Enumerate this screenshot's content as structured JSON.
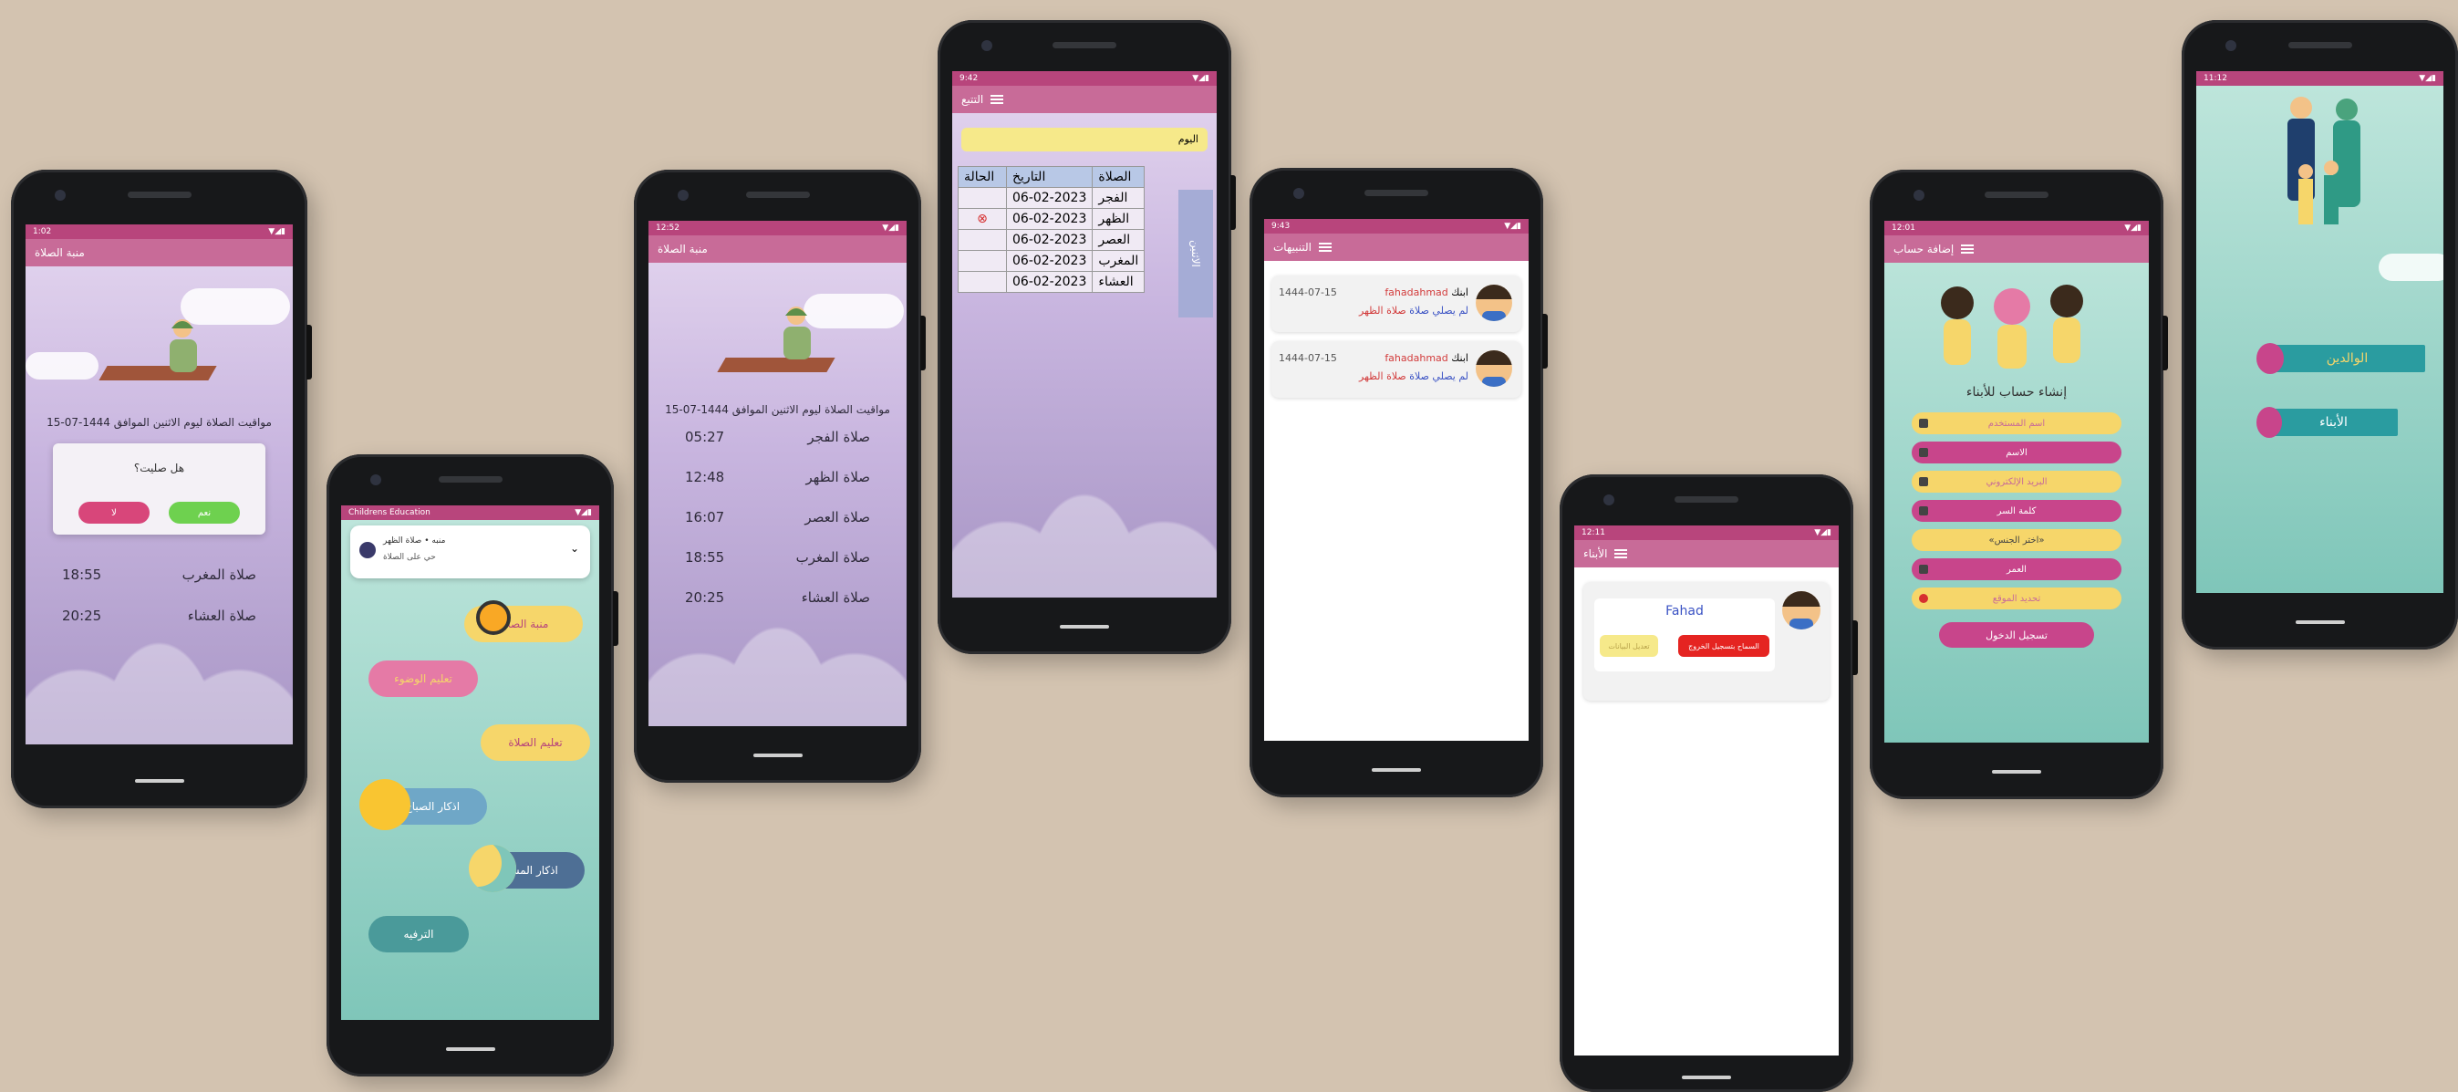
{
  "colors": {
    "background": "#d3c3b0",
    "status_bar": "#b8457c",
    "app_bar": "#c86b98",
    "accent_yellow": "#f6d66a",
    "accent_pink": "#c8458b"
  },
  "phone1": {
    "status_time": "1:02",
    "app_title": "منبة الصلاة",
    "date_line": "مواقيت الصلاة ليوم الاثنين الموافق 1444-07-15",
    "dialog": {
      "question": "هل صليت؟",
      "no_label": "لا",
      "yes_label": "نعم"
    },
    "prayers": [
      {
        "name": "صلاة المغرب",
        "time": "18:55"
      },
      {
        "name": "صلاة العشاء",
        "time": "20:25"
      }
    ]
  },
  "phone2": {
    "status_left": "Childrens Education",
    "notification": {
      "title": "منبه • صلاة الظهر",
      "body": "حي على الصلاة"
    },
    "menu": [
      {
        "label": "منبة الصلاة"
      },
      {
        "label": "تعليم الوضوء"
      },
      {
        "label": "تعليم الصلاة"
      },
      {
        "label": "اذكار الصباح"
      },
      {
        "label": "اذكار المساء"
      },
      {
        "label": "الترفيه"
      }
    ]
  },
  "phone3": {
    "status_time": "12:52",
    "app_title": "منبة الصلاة",
    "date_line": "مواقيت الصلاة ليوم الاثنين الموافق 1444-07-15",
    "prayers": [
      {
        "name": "صلاة الفجر",
        "time": "05:27"
      },
      {
        "name": "صلاة الظهر",
        "time": "12:48"
      },
      {
        "name": "صلاة العصر",
        "time": "16:07"
      },
      {
        "name": "صلاة المغرب",
        "time": "18:55"
      },
      {
        "name": "صلاة العشاء",
        "time": "20:25"
      }
    ]
  },
  "phone4": {
    "status_time": "9:42",
    "app_title": "التتبع",
    "day_chip": "اليوم",
    "side_tab": "الاثنين",
    "headers": {
      "prayer": "الصلاة",
      "date": "التاريخ",
      "status": "الحالة"
    },
    "rows": [
      {
        "prayer": "الفجر",
        "date": "06-02-2023",
        "missed": false
      },
      {
        "prayer": "الظهر",
        "date": "06-02-2023",
        "missed": true
      },
      {
        "prayer": "العصر",
        "date": "06-02-2023",
        "missed": false
      },
      {
        "prayer": "المغرب",
        "date": "06-02-2023",
        "missed": false
      },
      {
        "prayer": "العشاء",
        "date": "06-02-2023",
        "missed": false
      }
    ]
  },
  "phone5": {
    "status_time": "9:43",
    "app_title": "التنبيهات",
    "alerts": [
      {
        "prefix": "ابنك",
        "name": "fahadahmad",
        "date": "1444-07-15",
        "message": "لم يصلي صلاة",
        "prayer": "صلاة الظهر"
      },
      {
        "prefix": "ابنك",
        "name": "fahadahmad",
        "date": "1444-07-15",
        "message": "لم يصلي صلاة",
        "prayer": "صلاة الظهر"
      }
    ]
  },
  "phone6": {
    "status_time": "12:11",
    "app_title": "الأبناء",
    "child_name": "Fahad",
    "allow_exit_label": "السماح بتسجيل الخروج",
    "edit_label": "تعديل البيانات"
  },
  "phone7": {
    "status_time": "12:01",
    "app_title": "إضافة حساب",
    "heading": "إنشاء حساب للأبناء",
    "fields": [
      {
        "label": "اسم المستخدم"
      },
      {
        "label": "الاسم"
      },
      {
        "label": "البريد الإلكتروني"
      },
      {
        "label": "كلمة السر"
      },
      {
        "label": "«اختر الجنس»"
      },
      {
        "label": "العمر"
      },
      {
        "label": "تحديد الموقع"
      }
    ],
    "submit_label": "تسجيل الدخول"
  },
  "phone8": {
    "status_time": "11:12",
    "parents_label": "الوالدين",
    "children_label": "الأبناء"
  }
}
